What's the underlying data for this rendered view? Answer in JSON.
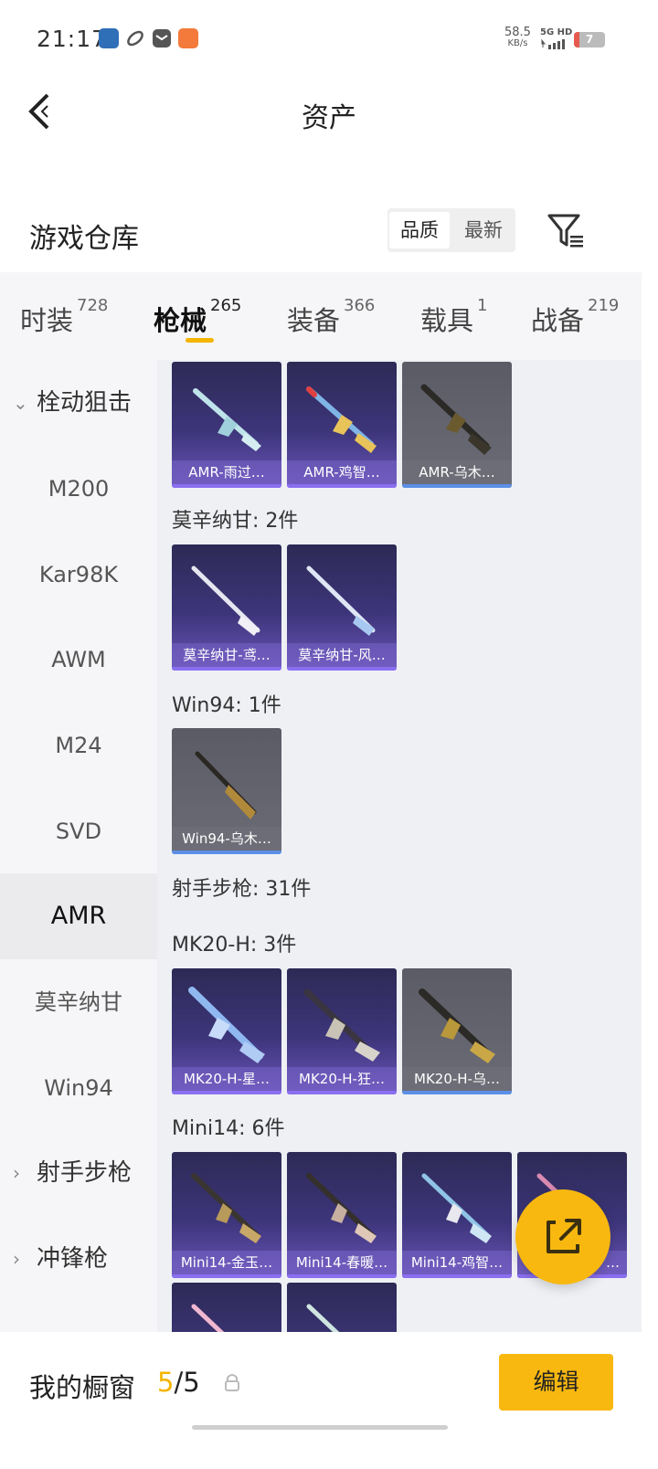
{
  "status_bar": {
    "time": "21:17",
    "speed_value": "58.5",
    "speed_unit": "KB/s",
    "network": "5G HD",
    "battery": "7",
    "notification_icons": [
      "game-app-icon",
      "link-app-icon",
      "mail-app-icon",
      "shopping-app-icon"
    ]
  },
  "header": {
    "title": "资产",
    "back_icon": "chevron-left-icon"
  },
  "warehouse": {
    "title": "游戏仓库",
    "sort_options": [
      "品质",
      "最新"
    ],
    "sort_selected": "品质",
    "filter_icon": "filter-icon"
  },
  "tabs": [
    {
      "label": "时装",
      "count": "728"
    },
    {
      "label": "枪械",
      "count": "265"
    },
    {
      "label": "装备",
      "count": "366"
    },
    {
      "label": "载具",
      "count": "1"
    },
    {
      "label": "战备",
      "count": "219"
    }
  ],
  "active_tab": "枪械",
  "sidebar": {
    "items": [
      {
        "label": "栓动狙击",
        "type": "category",
        "arrow": "⌄"
      },
      {
        "label": "M200",
        "type": "item"
      },
      {
        "label": "Kar98K",
        "type": "item"
      },
      {
        "label": "AWM",
        "type": "item"
      },
      {
        "label": "M24",
        "type": "item"
      },
      {
        "label": "SVD",
        "type": "item"
      },
      {
        "label": "AMR",
        "type": "item",
        "selected": true
      },
      {
        "label": "莫辛纳甘",
        "type": "item"
      },
      {
        "label": "Win94",
        "type": "item"
      },
      {
        "label": "射手步枪",
        "type": "category",
        "arrow": "›"
      },
      {
        "label": "冲锋枪",
        "type": "category",
        "arrow": "›"
      }
    ]
  },
  "content": {
    "groups": [
      {
        "label": "",
        "cards": [
          {
            "label": "AMR-雨过…",
            "rarity": "purple"
          },
          {
            "label": "AMR-鸡智…",
            "rarity": "purple"
          },
          {
            "label": "AMR-乌木…",
            "rarity": "grey"
          }
        ]
      },
      {
        "label": "莫辛纳甘: 2件",
        "cards": [
          {
            "label": "莫辛纳甘-鸢…",
            "rarity": "purple"
          },
          {
            "label": "莫辛纳甘-风…",
            "rarity": "purple"
          }
        ]
      },
      {
        "label": "Win94: 1件",
        "cards": [
          {
            "label": "Win94-乌木…",
            "rarity": "grey"
          }
        ]
      },
      {
        "label": "射手步枪: 31件",
        "cards": []
      },
      {
        "label": "MK20-H: 3件",
        "cards": [
          {
            "label": "MK20-H-星…",
            "rarity": "purple"
          },
          {
            "label": "MK20-H-狂…",
            "rarity": "purple"
          },
          {
            "label": "MK20-H-乌…",
            "rarity": "grey"
          }
        ]
      },
      {
        "label": "Mini14: 6件",
        "cards": [
          {
            "label": "Mini14-金玉…",
            "rarity": "purple"
          },
          {
            "label": "Mini14-春暖…",
            "rarity": "purple"
          },
          {
            "label": "Mini14-鸡智…",
            "rarity": "purple"
          },
          {
            "label": "…",
            "rarity": "purple"
          },
          {
            "label": "",
            "rarity": "purple"
          },
          {
            "label": "",
            "rarity": "purple"
          }
        ]
      }
    ]
  },
  "fab": {
    "icon": "share-external-icon"
  },
  "bottom_bar": {
    "showcase_label": "我的橱窗",
    "count_current": "5",
    "count_total": "/5",
    "lock_icon": "lock-icon",
    "edit_label": "编辑"
  },
  "colors": {
    "accent": "#f8b80f",
    "card_purple": "#3d357a",
    "card_grey": "#6c6c76"
  }
}
